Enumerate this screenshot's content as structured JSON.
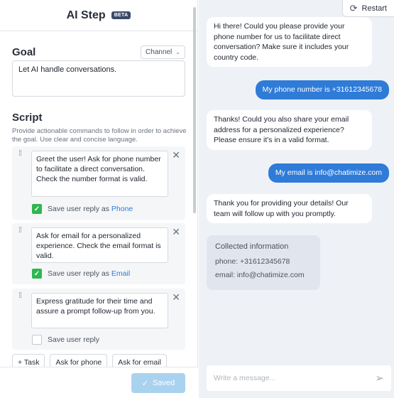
{
  "header": {
    "title": "AI Step",
    "badge": "BETA"
  },
  "goal": {
    "title": "Goal",
    "channel": "Channel",
    "text": "Let AI handle conversations."
  },
  "script": {
    "title": "Script",
    "description": "Provide actionable commands to follow in order to achieve the goal. Use clear and concise language.",
    "tasks": [
      {
        "text": "Greet the user! Ask for phone number to facilitate a direct conversation. Check the number format is valid.",
        "save_label": "Save user reply as",
        "variable": "Phone",
        "checked": true
      },
      {
        "text": "Ask for email for a personalized experience. Check the email format is valid.",
        "save_label": "Save user reply as",
        "variable": "Email",
        "checked": true
      },
      {
        "text": "Express gratitude for their time and assure a prompt follow-up from you.",
        "save_label": "Save user reply",
        "variable": "",
        "checked": false
      }
    ],
    "chips": [
      "+ Task",
      "Ask for phone",
      "Ask for email"
    ]
  },
  "footer": {
    "saved_label": "Saved"
  },
  "chat": {
    "restart_label": "Restart",
    "messages": [
      {
        "from": "bot",
        "text": "Hi there! Could you please provide your phone number for us to facilitate direct conversation? Make sure it includes your country code."
      },
      {
        "from": "user",
        "text": "My phone number is +31612345678"
      },
      {
        "from": "bot",
        "text": "Thanks! Could you also share your email address for a personalized experience? Please ensure it's in a valid format."
      },
      {
        "from": "user",
        "text": "My email is info@chatimize.com"
      },
      {
        "from": "bot",
        "text": "Thank you for providing your details! Our team will follow up with you promptly."
      }
    ],
    "collected": {
      "title": "Collected information",
      "phone": "phone: +31612345678",
      "email": "email: info@chatimize.com"
    },
    "composer_placeholder": "Write a message..."
  },
  "colors": {
    "accent": "#2f7bd8",
    "check": "#2fb64f",
    "chat_bg": "#eef2f7",
    "saved_button": "#a9d2ef"
  },
  "icons": {
    "restart": "refresh-icon",
    "send": "send-icon",
    "close": "close-icon",
    "drag": "drag-handle-icon",
    "checkbox": "check-icon"
  }
}
